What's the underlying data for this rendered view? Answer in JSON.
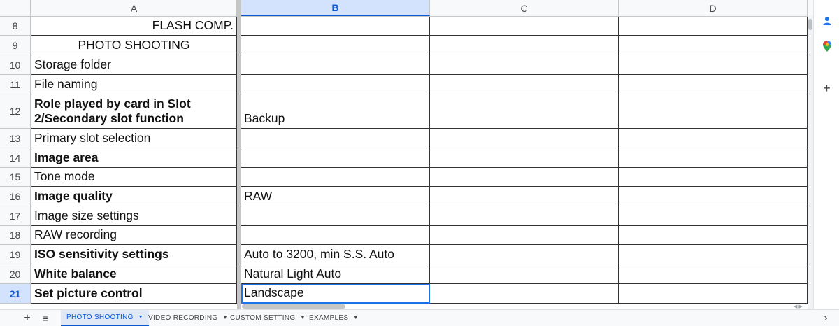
{
  "columns": [
    "A",
    "B",
    "C",
    "D"
  ],
  "rows": [
    {
      "num": "8",
      "a": "FLASH COMP.",
      "b": ""
    },
    {
      "num": "9",
      "a": "PHOTO SHOOTING",
      "b": ""
    },
    {
      "num": "10",
      "a": "Storage folder",
      "b": ""
    },
    {
      "num": "11",
      "a": "File naming",
      "b": ""
    },
    {
      "num": "12",
      "a": "Role played by card in Slot 2/Secondary slot function",
      "b": "Backup"
    },
    {
      "num": "13",
      "a": "Primary slot selection",
      "b": ""
    },
    {
      "num": "14",
      "a": "Image area",
      "b": ""
    },
    {
      "num": "15",
      "a": "Tone mode",
      "b": ""
    },
    {
      "num": "16",
      "a": "Image quality",
      "b": "RAW"
    },
    {
      "num": "17",
      "a": "Image size settings",
      "b": ""
    },
    {
      "num": "18",
      "a": "RAW recording",
      "b": ""
    },
    {
      "num": "19",
      "a": "ISO sensitivity settings",
      "b": "Auto to 3200, min S.S. Auto"
    },
    {
      "num": "20",
      "a": "White balance",
      "b": "Natural Light Auto"
    },
    {
      "num": "21",
      "a": "Set picture control",
      "b": "Landscape"
    }
  ],
  "sheet_tabs": {
    "add_label": "+",
    "menu_label": "≡",
    "tabs": [
      {
        "label": "PHOTO SHOOTING",
        "caret": "▼"
      },
      {
        "label": "VIDEO RECORDING",
        "caret": "▼"
      },
      {
        "label": "CUSTOM SETTING",
        "caret": "▼"
      },
      {
        "label": "EXAMPLES",
        "caret": "▼"
      }
    ],
    "collapse_label": "›"
  },
  "sidebar": {
    "add_label": "+"
  },
  "colors": {
    "selection": "#1a73e8",
    "header_selected_bg": "#d3e3fd",
    "contacts_blue": "#1a73e8"
  },
  "icons": [
    "contacts-icon",
    "maps-icon",
    "add-icon",
    "sheet-list-icon",
    "dropdown-caret-icon",
    "chevron-right-icon"
  ]
}
